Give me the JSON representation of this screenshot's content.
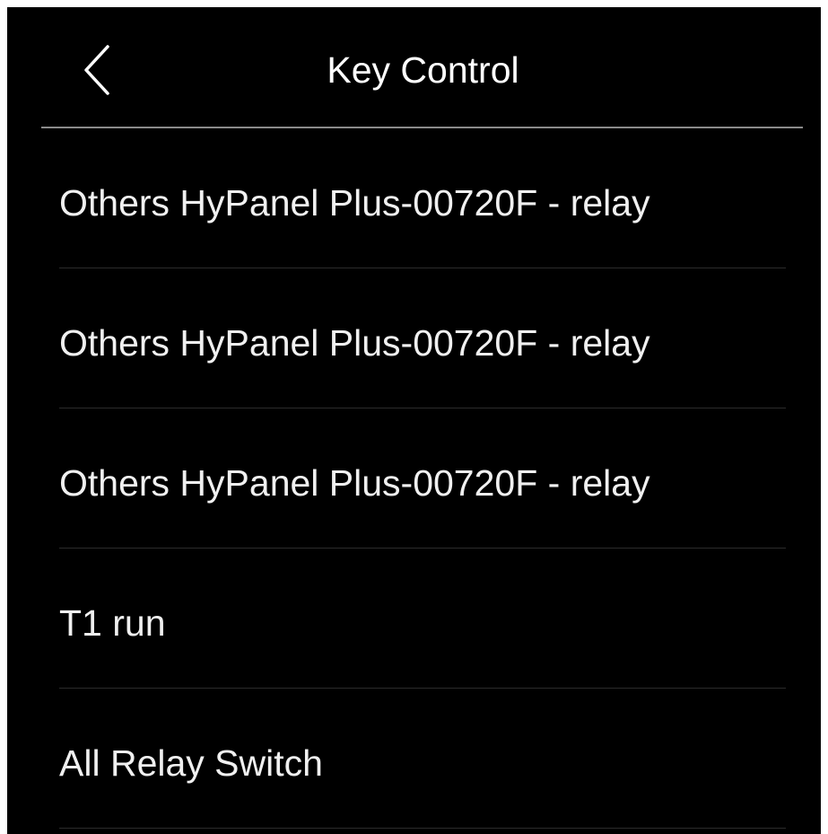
{
  "header": {
    "title": "Key Control",
    "back_icon": "chevron-left-icon"
  },
  "list": {
    "items": [
      {
        "label": "Others HyPanel Plus-00720F - relay"
      },
      {
        "label": "Others HyPanel Plus-00720F - relay"
      },
      {
        "label": "Others HyPanel Plus-00720F - relay"
      },
      {
        "label": "T1 run"
      },
      {
        "label": "All Relay Switch"
      }
    ]
  },
  "colors": {
    "background": "#000000",
    "text": "#f2f2f2",
    "header_divider": "#8a8a8a",
    "item_divider": "#2b2b2b"
  }
}
